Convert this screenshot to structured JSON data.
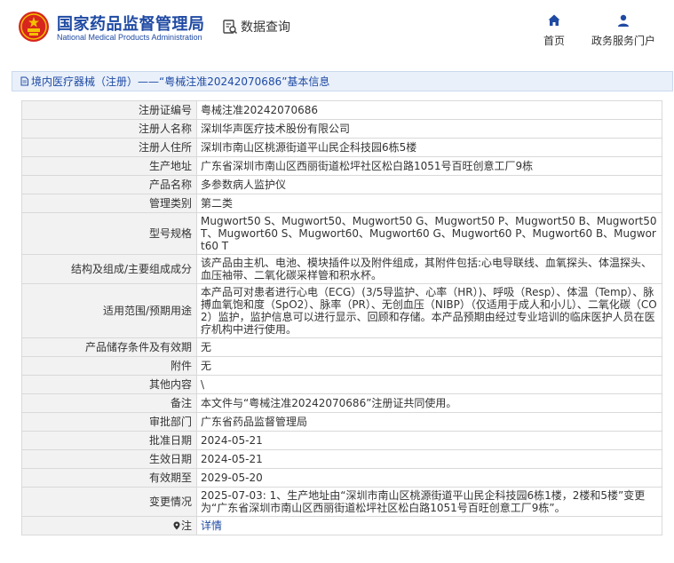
{
  "header": {
    "org_cn": "国家药品监督管理局",
    "org_en": "National Medical Products Administration",
    "query_label": "数据查询",
    "nav": [
      {
        "label": "首页",
        "icon": "home-icon"
      },
      {
        "label": "政务服务门户",
        "icon": "user-icon"
      }
    ]
  },
  "breadcrumb": {
    "category": "境内医疗器械（注册）",
    "separator": " —— ",
    "subject": "“粤械注准20242070686”基本信息"
  },
  "fields": {
    "reg_no": {
      "label": "注册证编号",
      "value": "粤械注准20242070686"
    },
    "registrant": {
      "label": "注册人名称",
      "value": "深圳华声医疗技术股份有限公司"
    },
    "registrant_addr": {
      "label": "注册人住所",
      "value": "深圳市南山区桃源街道平山民企科技园6栋5楼"
    },
    "production_addr": {
      "label": "生产地址",
      "value": "广东省深圳市南山区西丽街道松坪社区松白路1051号百旺创意工厂9栋"
    },
    "product_name": {
      "label": "产品名称",
      "value": "多参数病人监护仪"
    },
    "mgmt_class": {
      "label": "管理类别",
      "value": "第二类"
    },
    "model_spec": {
      "label": "型号规格",
      "value": "Mugwort50 S、Mugwort50、Mugwort50 G、Mugwort50 P、Mugwort50 B、Mugwort50 T、Mugwort60 S、Mugwort60、Mugwort60 G、Mugwort60 P、Mugwort60 B、Mugwort60 T"
    },
    "structure": {
      "label": "结构及组成/主要组成成分",
      "value": "该产品由主机、电池、模块插件以及附件组成，其附件包括:心电导联线、血氧探头、体温探头、血压袖带、二氧化碳采样管和积水杯。"
    },
    "scope": {
      "label": "适用范围/预期用途",
      "value": "本产品可对患者进行心电（ECG）(3/5导监护、心率（HR）)、呼吸（Resp）、体温（Temp）、脉搏血氧饱和度（SpO2）、脉率（PR）、无创血压（NIBP）（仅适用于成人和小儿）、二氧化碳（CO2）监护，监护信息可以进行显示、回顾和存储。本产品预期由经过专业培训的临床医护人员在医疗机构中进行使用。"
    },
    "storage": {
      "label": "产品储存条件及有效期",
      "value": "无"
    },
    "accessory": {
      "label": "附件",
      "value": "无"
    },
    "other": {
      "label": "其他内容",
      "value": "\\"
    },
    "remark": {
      "label": "备注",
      "value": "本文件与“粤械注准20242070686”注册证共同使用。"
    },
    "approval_dept": {
      "label": "审批部门",
      "value": "广东省药品监督管理局"
    },
    "approval_date": {
      "label": "批准日期",
      "value": "2024-05-21"
    },
    "effective_date": {
      "label": "生效日期",
      "value": "2024-05-21"
    },
    "expiry_date": {
      "label": "有效期至",
      "value": "2029-05-20"
    },
    "change": {
      "label": "变更情况",
      "value": "2025-07-03: 1、生产地址由“深圳市南山区桃源街道平山民企科技园6栋1楼，2楼和5楼”变更为“广东省深圳市南山区西丽街道松坪社区松白路1051号百旺创意工厂9栋”。"
    },
    "note": {
      "label": "注",
      "link": "详情"
    }
  },
  "colors": {
    "brand_blue": "#1f4aa3",
    "logo_red": "#d7261e",
    "logo_gold": "#f4c200"
  }
}
